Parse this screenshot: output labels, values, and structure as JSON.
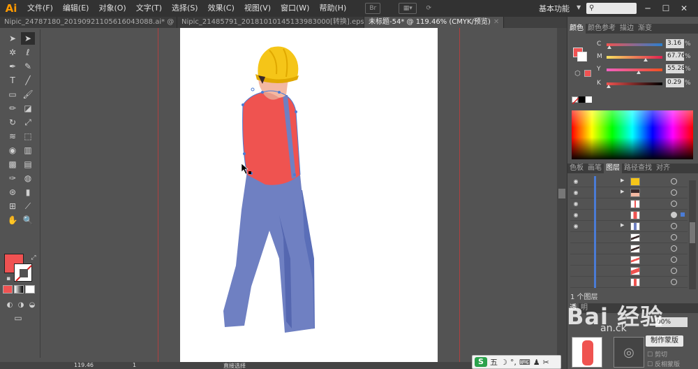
{
  "app": {
    "logo": "Ai"
  },
  "menubar": {
    "items": [
      "文件(F)",
      "编辑(E)",
      "对象(O)",
      "文字(T)",
      "选择(S)",
      "效果(C)",
      "视图(V)",
      "窗口(W)",
      "帮助(H)"
    ],
    "br_icon": "Br",
    "workspace": "基本功能",
    "search_icon": "search-icon"
  },
  "tabs": [
    {
      "label": "Nipic_24787180_20190921105616043088.ai* @ 50..."
    },
    {
      "label": "Nipic_21485791_20181010145133983000[转换].eps*"
    },
    {
      "label": "未标题-54* @ 119.46% (CMYK/预览)"
    }
  ],
  "status": {
    "zoom": "119.46",
    "page": "1",
    "tool_label": "直接选择"
  },
  "color_panel": {
    "tabs": [
      "颜色",
      "颜色参考",
      "描边",
      "渐变"
    ],
    "sliders": [
      {
        "letter": "C",
        "value": "3.16",
        "unit": "%"
      },
      {
        "letter": "M",
        "value": "67.76",
        "unit": "%"
      },
      {
        "letter": "Y",
        "value": "55.28",
        "unit": "%"
      },
      {
        "letter": "K",
        "value": "0.29",
        "unit": "%"
      }
    ],
    "fill_color": "#f05252"
  },
  "layers_panel": {
    "tabs": [
      "色板",
      "画笔",
      "图层",
      "路径查找",
      "对齐"
    ],
    "layer_count": "1 个图层",
    "rows": 10
  },
  "transparency_panel": {
    "tabs": [
      "透",
      "明"
    ],
    "opacity_value": "00%",
    "make_mask_button": "制作蒙版",
    "clip_label": "剪切",
    "invert_mask_label": "反相蒙版"
  },
  "ime": {
    "logo": "S",
    "label": "五"
  },
  "watermark": {
    "text": "Bai 经验",
    "sub": "an.ck"
  }
}
